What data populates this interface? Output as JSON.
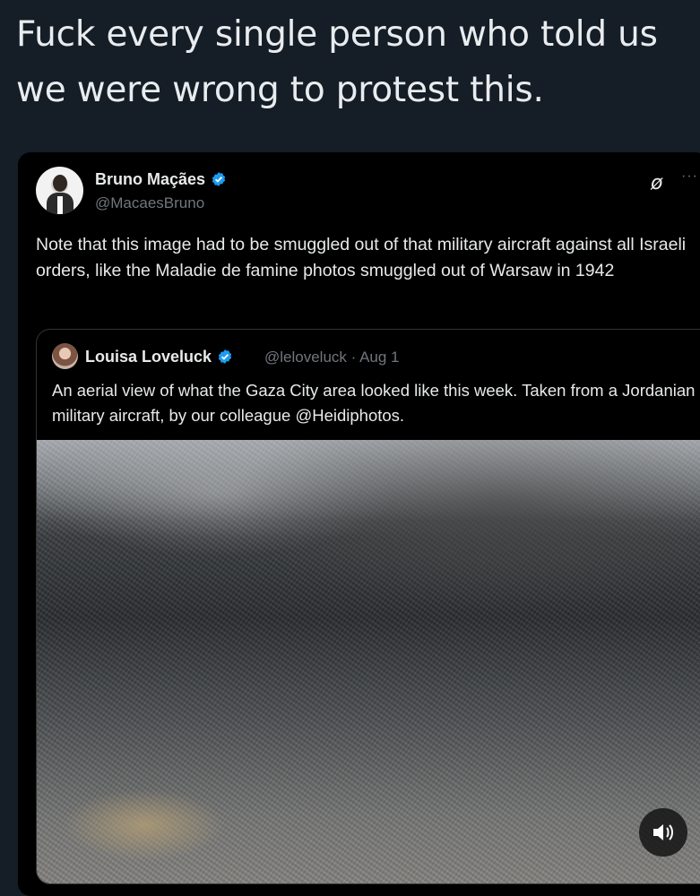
{
  "post": {
    "headline": "Fuck every single person who told us we were wrong to protest this."
  },
  "tweet": {
    "author_name": "Bruno Maçães",
    "author_handle": "@MacaesBruno",
    "text": "Note that this image had to be smuggled out of that military aircraft against all Israeli orders, like the Maladie de famine photos smuggled out of Warsaw in 1942",
    "icons": {
      "grok": "grok-icon",
      "more": "more-options-icon",
      "verified": "verified-badge-icon"
    },
    "accent_color": "#1d9bf0"
  },
  "quote": {
    "author_name": "Louisa Loveluck",
    "meta": "@leloveluck · Aug 1",
    "text": "An aerial view of what the Gaza City area looked like this week. Taken from a Jordanian military aircraft, by our colleague @Heidiphotos.",
    "media_icon": "speaker-icon"
  }
}
